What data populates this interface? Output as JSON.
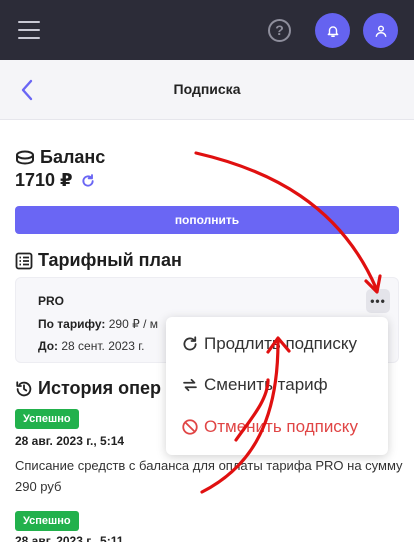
{
  "header": {
    "icons": [
      "menu-icon",
      "help-icon",
      "bell-icon",
      "user-icon"
    ],
    "help_glyph": "?"
  },
  "subheader": {
    "title": "Подписка"
  },
  "balance": {
    "title": "Баланс",
    "amount": "1710 ₽",
    "topup_label": "пополнить"
  },
  "plan": {
    "title": "Тарифный план",
    "name": "PRO",
    "tariff_label": "По тарифу:",
    "tariff_value": "290 ₽ / м",
    "until_label": "До:",
    "until_value": "28 сент. 2023 г.",
    "more_glyph": "•••"
  },
  "history": {
    "title": "История опер",
    "items": [
      {
        "status": "Успешно",
        "date": "28 авг. 2023 г., 5:14",
        "description": "Списание средств с баланса для оплаты тарифа PRO на сумму 290 руб"
      },
      {
        "status": "Успешно",
        "date": "28 авг. 2023 г., 5:11"
      }
    ]
  },
  "context_menu": {
    "items": [
      {
        "label": "Продлить подписку",
        "icon": "renew-icon"
      },
      {
        "label": "Сменить тариф",
        "icon": "swap-icon"
      },
      {
        "label": "Отменить подписку",
        "icon": "cancel-icon"
      }
    ]
  },
  "colors": {
    "topbar": "#2c2c38",
    "accent": "#6a66f4",
    "success": "#22b14c",
    "danger": "#e04545",
    "annotation": "#e01010"
  }
}
